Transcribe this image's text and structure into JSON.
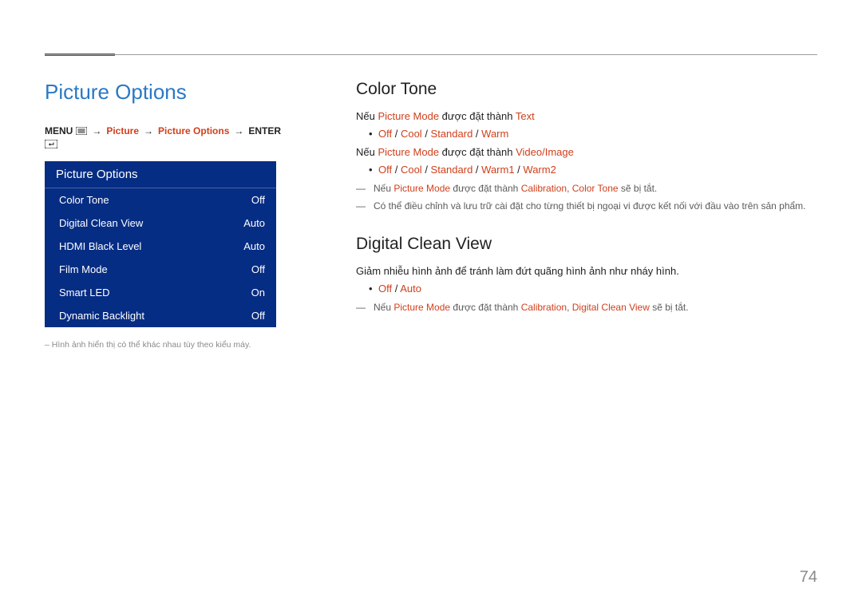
{
  "page_number": "74",
  "left": {
    "h1": "Picture Options",
    "breadcrumb": {
      "menu": "MENU",
      "items": [
        "Picture",
        "Picture Options"
      ],
      "enter": "ENTER"
    },
    "osd": {
      "title": "Picture Options",
      "rows": [
        {
          "label": "Color Tone",
          "value": "Off"
        },
        {
          "label": "Digital Clean View",
          "value": "Auto"
        },
        {
          "label": "HDMI Black Level",
          "value": "Auto"
        },
        {
          "label": "Film Mode",
          "value": "Off"
        },
        {
          "label": "Smart LED",
          "value": "On"
        },
        {
          "label": "Dynamic Backlight",
          "value": "Off"
        }
      ]
    },
    "footnote": "Hình ảnh hiển thị có thể khác nhau tùy theo kiểu máy."
  },
  "right": {
    "color_tone": {
      "heading": "Color Tone",
      "line1_pre": "Nếu ",
      "line1_hl1": "Picture Mode",
      "line1_mid": " được đặt thành ",
      "line1_hl2": "Text",
      "opts1": [
        "Off",
        "Cool",
        "Standard",
        "Warm"
      ],
      "line2_pre": "Nếu ",
      "line2_hl1": "Picture Mode",
      "line2_mid": " được đặt thành ",
      "line2_hl2": "Video/Image",
      "opts2": [
        "Off",
        "Cool",
        "Standard",
        "Warm1",
        "Warm2"
      ],
      "note1_pre": "Nếu ",
      "note1_hl1": "Picture Mode",
      "note1_mid": " được đặt thành ",
      "note1_hl2": "Calibration",
      "note1_sep": ", ",
      "note1_hl3": "Color Tone",
      "note1_suf": " sẽ bị tắt.",
      "note2": "Có thể điều chỉnh và lưu trữ cài đặt cho từng thiết bị ngoại vi được kết nối với đầu vào trên sản phẩm."
    },
    "digital_clean_view": {
      "heading": "Digital Clean View",
      "para": "Giảm nhiễu hình ảnh để tránh làm đứt quãng hình ảnh như nháy hình.",
      "opts": [
        "Off",
        "Auto"
      ],
      "note_pre": "Nếu ",
      "note_hl1": "Picture Mode",
      "note_mid": " được đặt thành ",
      "note_hl2": "Calibration",
      "note_sep": ", ",
      "note_hl3": "Digital Clean View",
      "note_suf": " sẽ bị tắt."
    }
  }
}
